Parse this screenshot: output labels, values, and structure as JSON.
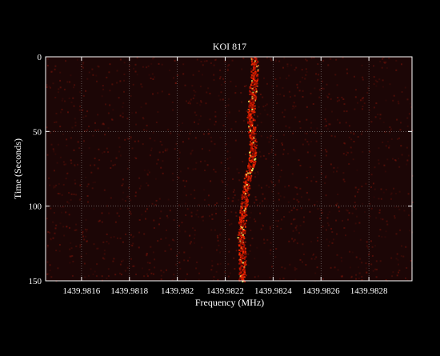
{
  "chart_data": {
    "type": "heatmap",
    "title": "KOI 817",
    "xlabel": "Frequency (MHz)",
    "ylabel": "Time (Seconds)",
    "xlim": [
      1439.98145,
      1439.98298
    ],
    "ylim": [
      0,
      150
    ],
    "y_inverted": true,
    "xticks": [
      1439.9816,
      1439.9818,
      1439.982,
      1439.9822,
      1439.9824,
      1439.9826,
      1439.9828
    ],
    "xtick_labels": [
      "1439.9816",
      "1439.9818",
      "1439.982",
      "1439.9822",
      "1439.9824",
      "1439.9826",
      "1439.9828"
    ],
    "yticks": [
      0,
      50,
      100,
      150
    ],
    "ytick_labels": [
      "0",
      "50",
      "100",
      "150"
    ],
    "grid": true,
    "colormap": "hot",
    "signal_track": {
      "time": [
        0,
        10,
        20,
        30,
        40,
        50,
        60,
        70,
        80,
        90,
        100,
        110,
        120,
        130,
        140,
        150
      ],
      "frequency": [
        1439.98232,
        1439.98232,
        1439.982315,
        1439.98231,
        1439.982305,
        1439.98231,
        1439.982315,
        1439.98231,
        1439.98229,
        1439.982285,
        1439.982275,
        1439.98227,
        1439.982265,
        1439.98227,
        1439.98227,
        1439.98227
      ]
    }
  },
  "colors": {
    "background": "#000000",
    "plot_background": "#1c0606",
    "axis": "#ffffff",
    "grid": "#8a8a8a",
    "signal": "#ff2a00",
    "signal_peak": "#ffff66"
  }
}
